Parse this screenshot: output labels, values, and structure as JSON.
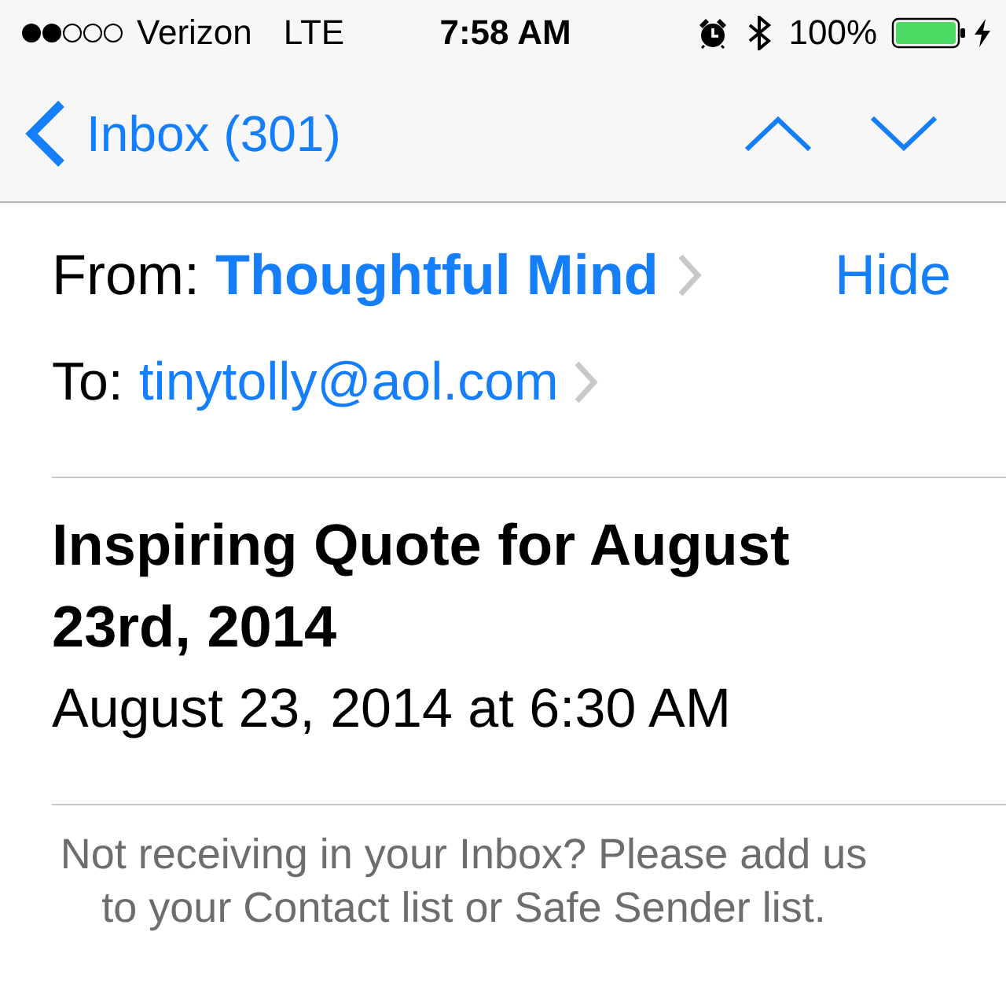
{
  "status_bar": {
    "carrier": "Verizon",
    "network": "LTE",
    "time": "7:58 AM",
    "alarm": true,
    "bluetooth": true,
    "battery": "100%",
    "charging": true
  },
  "nav_bar": {
    "back_label": "Inbox (301)"
  },
  "header": {
    "from_label": "From:",
    "sender": "Thoughtful Mind",
    "hide_label": "Hide",
    "to_label": "To:",
    "recipient": "tinytolly@aol.com"
  },
  "message": {
    "subject": "Inspiring Quote for August 23rd, 2014",
    "date": "August 23, 2014 at 6:30 AM",
    "body": "Not receiving in your Inbox? Please add us to your Contact list or Safe Sender list."
  }
}
